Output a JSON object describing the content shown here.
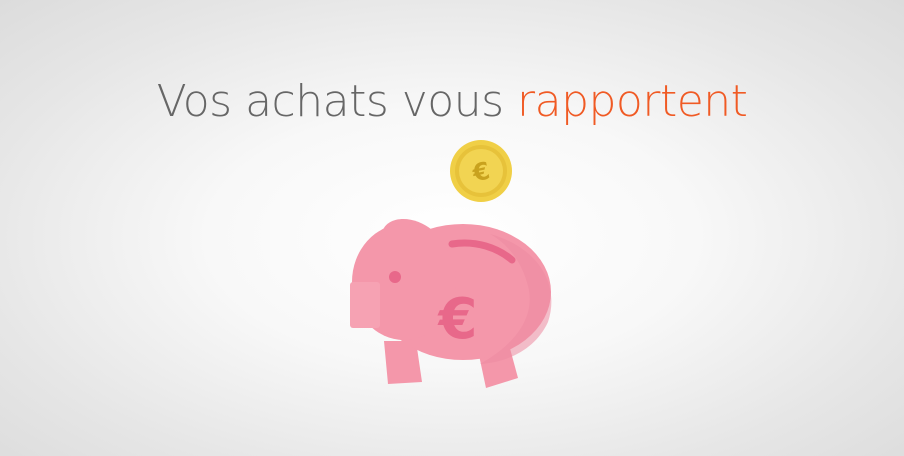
{
  "headline": {
    "part1": "Vos achats vous ",
    "part2": "rapportent"
  },
  "illustration": {
    "coin_symbol": "€",
    "piggy_symbol": "€",
    "icons": [
      "coin-icon",
      "piggy-bank-icon",
      "euro-icon"
    ]
  },
  "colors": {
    "background": "#efefef",
    "text": "#666666",
    "accent": "#f05a24",
    "coin": "#f1d34d",
    "piggy": "#f497aa",
    "piggy_dark": "#e8688a"
  }
}
